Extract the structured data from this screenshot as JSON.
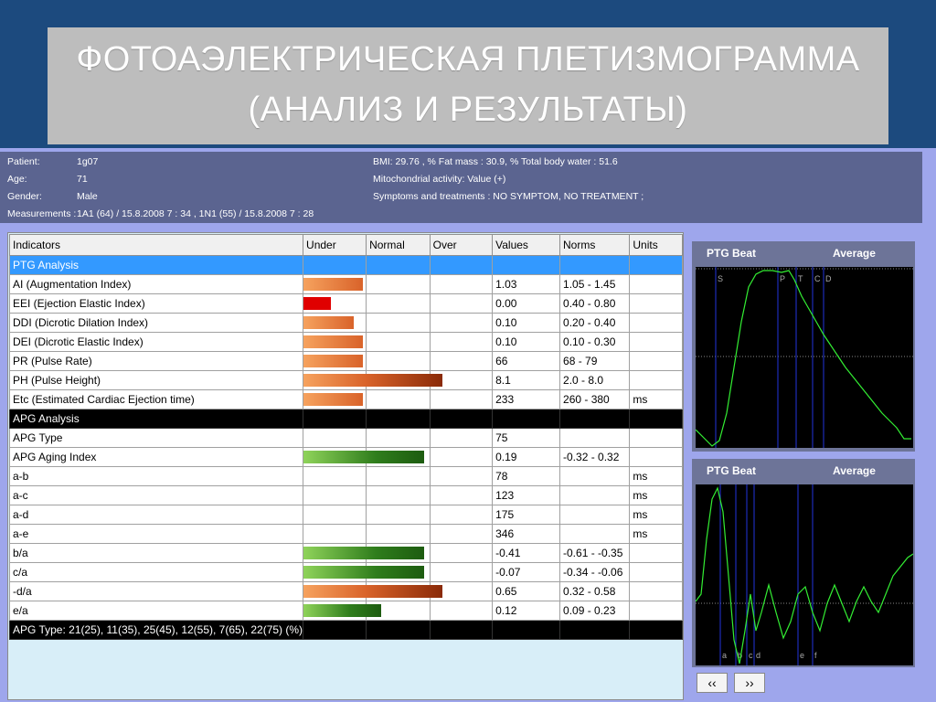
{
  "slide": {
    "title_line1": "ФОТОАЭЛЕКТРИЧЕСКАЯ ПЛЕТИЗМОГРАММА",
    "title_line2": "(АНАЛИЗ И РЕЗУЛЬТАТЫ)"
  },
  "patient": {
    "patient_label": "Patient:",
    "patient_value": "1g07",
    "age_label": "Age:",
    "age_value": "71",
    "gender_label": "Gender:",
    "gender_value": "Male",
    "measurements_label": "Measurements :",
    "measurements_value": "1A1  (64)  / 15.8.2008  7 : 34 , 1N1  (55)  / 15.8.2008  7 : 28",
    "bmi_line": "BMI:   29.76  ,  % Fat mass : 30.9,  % Total body water  : 51.6",
    "mito_line": "Mitochondrial activity: Value (+)",
    "symptoms_line": "Symptoms and treatments : NO SYMPTOM, NO TREATMENT ;"
  },
  "table": {
    "headers": [
      "Indicators",
      "Under",
      "Normal",
      "Over",
      "Values",
      "Norms",
      "Units"
    ],
    "ptg_section": "PTG Analysis",
    "apg_section": "APG Analysis",
    "footer": "APG Type: 21(25), 11(35), 25(45), 12(55), 7(65), 22(75) (%)",
    "rows": [
      {
        "name": "AI (Augmentation Index)",
        "value": "1.03",
        "norm": "1.05 - 1.45",
        "unit": "",
        "bar_level": 0.43,
        "bar_color": "orange"
      },
      {
        "name": "EEI (Ejection Elastic Index)",
        "value": "0.00",
        "norm": "0.40 - 0.80",
        "unit": "",
        "bar_level": 0.2,
        "bar_color": "red"
      },
      {
        "name": "DDI (Dicrotic Dilation Index)",
        "value": "0.10",
        "norm": "0.20 - 0.40",
        "unit": "",
        "bar_level": 0.36,
        "bar_color": "orange"
      },
      {
        "name": "DEI (Dicrotic Elastic Index)",
        "value": "0.10",
        "norm": "0.10 - 0.30",
        "unit": "",
        "bar_level": 0.43,
        "bar_color": "orange"
      },
      {
        "name": "PR (Pulse Rate)",
        "value": "66",
        "norm": "68 - 79",
        "unit": "",
        "bar_level": 0.43,
        "bar_color": "orange"
      },
      {
        "name": "PH (Pulse Height)",
        "value": "8.1",
        "norm": "2.0 - 8.0",
        "unit": "",
        "bar_level": 1.0,
        "bar_color": "brown"
      },
      {
        "name": "Etc (Estimated Cardiac Ejection time)",
        "value": "233",
        "norm": "260 - 380",
        "unit": "ms",
        "bar_level": 0.43,
        "bar_color": "orange"
      }
    ],
    "apg_rows": [
      {
        "name": "APG Type",
        "value": "75",
        "norm": "",
        "unit": "",
        "bar_level": 0,
        "bar_color": ""
      },
      {
        "name": "APG Aging Index",
        "value": "0.19",
        "norm": "-0.32 - 0.32",
        "unit": "",
        "bar_level": 0.87,
        "bar_color": "green"
      },
      {
        "name": "a-b",
        "value": "78",
        "norm": "",
        "unit": "ms",
        "bar_level": 0,
        "bar_color": ""
      },
      {
        "name": "a-c",
        "value": "123",
        "norm": "",
        "unit": "ms",
        "bar_level": 0,
        "bar_color": ""
      },
      {
        "name": "a-d",
        "value": "175",
        "norm": "",
        "unit": "ms",
        "bar_level": 0,
        "bar_color": ""
      },
      {
        "name": "a-e",
        "value": "346",
        "norm": "",
        "unit": "ms",
        "bar_level": 0,
        "bar_color": ""
      },
      {
        "name": "b/a",
        "value": "-0.41",
        "norm": "-0.61 - -0.35",
        "unit": "",
        "bar_level": 0.87,
        "bar_color": "green"
      },
      {
        "name": "c/a",
        "value": "-0.07",
        "norm": "-0.34 - -0.06",
        "unit": "",
        "bar_level": 0.87,
        "bar_color": "green"
      },
      {
        "name": "-d/a",
        "value": "0.65",
        "norm": "0.32 - 0.58",
        "unit": "",
        "bar_level": 1.0,
        "bar_color": "brown"
      },
      {
        "name": "e/a",
        "value": "0.12",
        "norm": "0.09 - 0.23",
        "unit": "",
        "bar_level": 0.56,
        "bar_color": "green"
      }
    ]
  },
  "graphs": {
    "ptg": {
      "title": "PTG Beat",
      "subtitle": "Average",
      "markers": [
        "S",
        "P",
        "T",
        "C",
        "D"
      ]
    },
    "apg": {
      "title": "PTG Beat",
      "subtitle": "Average",
      "markers": [
        "a",
        "b",
        "c",
        "d",
        "e",
        "f"
      ]
    }
  },
  "nav": {
    "prev_label": "‹‹",
    "next_label": "››"
  },
  "colors": {
    "slide_bg": "#1c4a7e",
    "title_bg": "#bdbdbd",
    "screen_bg": "#9ea6ec",
    "header_bg": "#5b6490",
    "ptg_section": "#3399ff",
    "wave": "#33ee33",
    "marker_line": "#2233dd"
  }
}
